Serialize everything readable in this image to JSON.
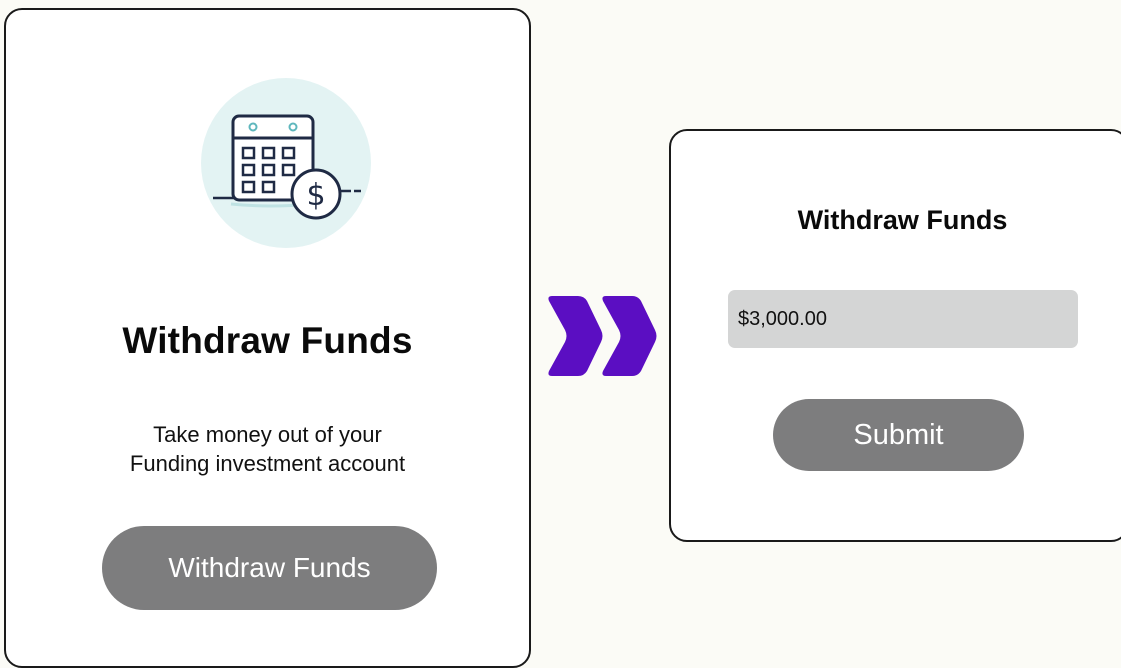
{
  "left_card": {
    "icon": "calendar-dollar-icon",
    "title": "Withdraw Funds",
    "description_line1": "Take money out of your",
    "description_line2": "Funding investment account",
    "button_label": "Withdraw Funds"
  },
  "transition": {
    "icon": "double-chevron-right-icon",
    "color": "#5b0ec2"
  },
  "right_card": {
    "title": "Withdraw Funds",
    "amount_value": "$3,000.00",
    "submit_label": "Submit"
  },
  "colors": {
    "button_gray": "#7d7d7e",
    "input_gray": "#d4d5d5",
    "icon_circle": "#e3f3f3",
    "icon_stroke": "#1f2a44",
    "icon_accent": "#5fb7bd",
    "accent_purple": "#5b0ec2"
  }
}
